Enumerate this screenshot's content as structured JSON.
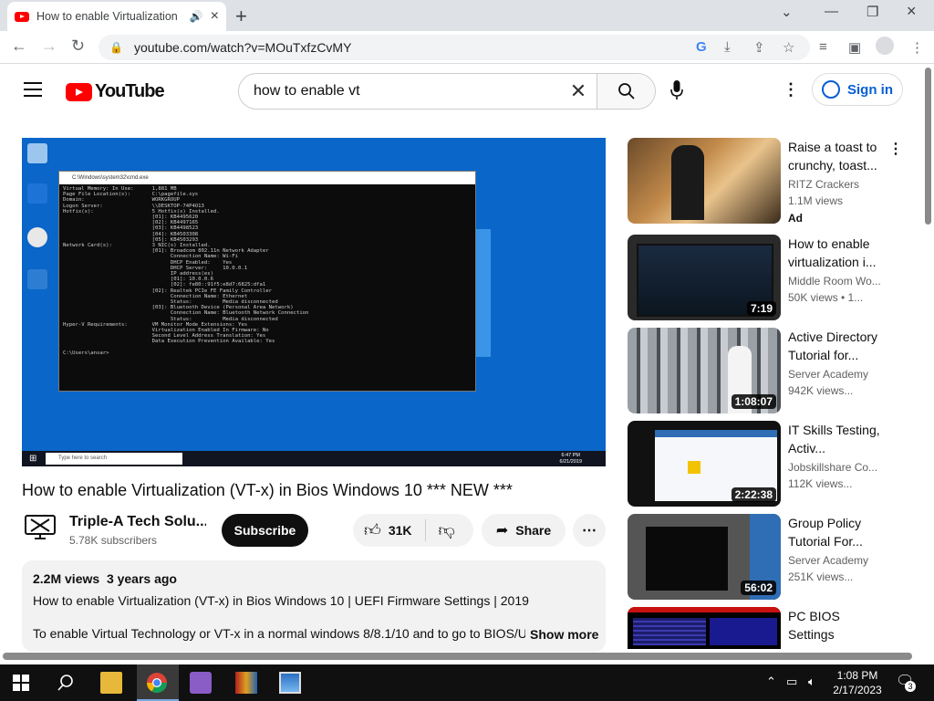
{
  "browser": {
    "tab_title": "How to enable Virtualization",
    "url": "youtube.com/watch?v=MOuTxfzCvMY"
  },
  "masthead": {
    "logo_text": "YouTube",
    "search_query": "how to enable vt",
    "signin_label": "Sign in"
  },
  "video": {
    "title": "How to enable Virtualization (VT-x) in Bios Windows 10 *** NEW ***",
    "channel_name": "Triple-A Tech Solu...",
    "subscribers": "5.78K subscribers",
    "subscribe_label": "Subscribe",
    "likes": "31K",
    "share_label": "Share",
    "views": "2.2M views",
    "age": "3 years ago",
    "description_line1": "How to enable Virtualization (VT-x)  in Bios Windows 10 | UEFI Firmware Settings | 2019",
    "description_line2": "To enable Virtual Technology or VT-x in a normal windows 8/8.1/10 and to go to BIOS/UEFI",
    "show_more_label": "Show more"
  },
  "player": {
    "cmd_title": "C:\\Windows\\system32\\cmd.exe",
    "cmd_text": "Virtual Memory: In Use:      1,881 MB\nPage File Location(s):       C:\\pagefile.sys\nDomain:                      WORKGROUP\nLogon Server:                \\\\DESKTOP-74P4O13\nHotfix(s):                   5 Hotfix(s) Installed.\n                             [01]: KB4495620\n                             [02]: KB4497165\n                             [03]: KB4498523\n                             [04]: KB4503308\n                             [05]: KB4503293\nNetwork Card(s):             3 NIC(s) Installed.\n                             [01]: Broadcom 802.11n Network Adapter\n                                   Connection Name: Wi-Fi\n                                   DHCP Enabled:    Yes\n                                   DHCP Server:     10.0.0.1\n                                   IP address(es)\n                                   [01]: 10.0.0.6\n                                   [02]: fe80::91f5:e8d7:6825:dfa1\n                             [02]: Realtek PCIe FE Family Controller\n                                   Connection Name: Ethernet\n                                   Status:          Media disconnected\n                             [03]: Bluetooth Device (Personal Area Network)\n                                   Connection Name: Bluetooth Network Connection\n                                   Status:          Media disconnected\nHyper-V Requirements:        VM Monitor Mode Extensions: Yes\n                             Virtualization Enabled In Firmware: No\n                             Second Level Address Translation: Yes\n                             Data Execution Prevention Available: Yes\n\nC:\\Users\\ansar>",
    "search_placeholder": "Type here to search",
    "clock_time": "6:47 PM",
    "clock_date": "6/21/2019"
  },
  "recommendations": [
    {
      "title": "Raise a toast to crunchy, toast...",
      "channel": "RITZ Crackers",
      "views": "1.1M views",
      "badge": "Ad",
      "duration": ""
    },
    {
      "title": "How to enable virtualization i...",
      "channel": "Middle Room Wo...",
      "views": "50K views  • 1...",
      "badge": "",
      "duration": "7:19"
    },
    {
      "title": "Active Directory Tutorial for...",
      "channel": "Server Academy",
      "views": "942K views...",
      "badge": "",
      "duration": "1:08:07"
    },
    {
      "title": "IT Skills Testing, Activ...",
      "channel": "Jobskillshare Co...",
      "views": "112K views...",
      "badge": "",
      "duration": "2:22:38"
    },
    {
      "title": "Group Policy Tutorial For...",
      "channel": "Server Academy",
      "views": "251K views...",
      "badge": "",
      "duration": "56:02"
    },
    {
      "title": "PC BIOS Settings",
      "channel": "",
      "views": "",
      "badge": "",
      "duration": ""
    }
  ],
  "taskbar": {
    "time": "1:08 PM",
    "date": "2/17/2023",
    "notifications": "3"
  }
}
